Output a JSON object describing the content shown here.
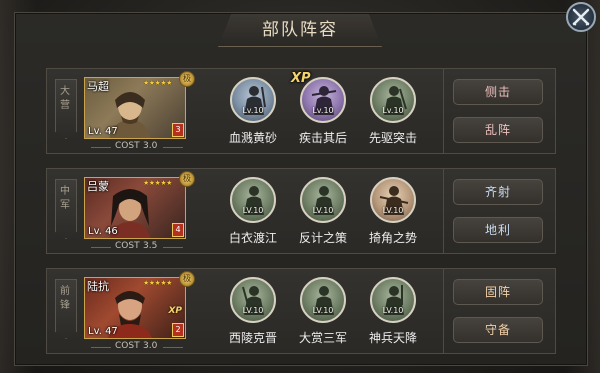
{
  "header": {
    "title": "部队阵容"
  },
  "colors": {
    "gold": "#c9a44c",
    "star": "#f3c93e",
    "xp": "#f4d46a"
  },
  "rows": [
    {
      "banner": "大营",
      "general": {
        "name": "马超",
        "level": "Lv. 47",
        "rank_medal": "极",
        "stars": "★★★★★",
        "count": "3",
        "cost_label": "COST",
        "cost": "3.0",
        "xp": ""
      },
      "skills": [
        {
          "name": "血溅黄砂",
          "level": "Lv.10",
          "xp": "",
          "icon": "soldier-silhouette-icon"
        },
        {
          "name": "疾击其后",
          "level": "Lv.10",
          "xp": "XP",
          "icon": "soldier-silhouette-icon"
        },
        {
          "name": "先驱突击",
          "level": "Lv.10",
          "xp": "",
          "icon": "soldier-silhouette-icon"
        }
      ],
      "actions": [
        "侧击",
        "乱阵"
      ]
    },
    {
      "banner": "中军",
      "general": {
        "name": "吕蒙",
        "level": "Lv. 46",
        "rank_medal": "极",
        "stars": "★★★★★",
        "count": "4",
        "cost_label": "COST",
        "cost": "3.5",
        "xp": ""
      },
      "skills": [
        {
          "name": "白衣渡江",
          "level": "LV.10",
          "xp": "",
          "icon": "soldier-silhouette-icon"
        },
        {
          "name": "反计之策",
          "level": "LV.10",
          "xp": "",
          "icon": "soldier-silhouette-icon"
        },
        {
          "name": "掎角之势",
          "level": "LV.10",
          "xp": "",
          "icon": "soldier-silhouette-icon"
        }
      ],
      "actions": [
        "齐射",
        "地利"
      ]
    },
    {
      "banner": "前锋",
      "general": {
        "name": "陆抗",
        "level": "Lv. 47",
        "rank_medal": "极",
        "stars": "★★★★★",
        "count": "2",
        "cost_label": "COST",
        "cost": "3.0",
        "xp": "XP"
      },
      "skills": [
        {
          "name": "西陵克晋",
          "level": "LV.10",
          "xp": "",
          "icon": "soldier-silhouette-icon"
        },
        {
          "name": "大赏三军",
          "level": "LV.10",
          "xp": "",
          "icon": "soldier-silhouette-icon"
        },
        {
          "name": "神兵天降",
          "level": "LV.10",
          "xp": "",
          "icon": "soldier-silhouette-icon"
        }
      ],
      "actions": [
        "固阵",
        "守备"
      ]
    }
  ]
}
